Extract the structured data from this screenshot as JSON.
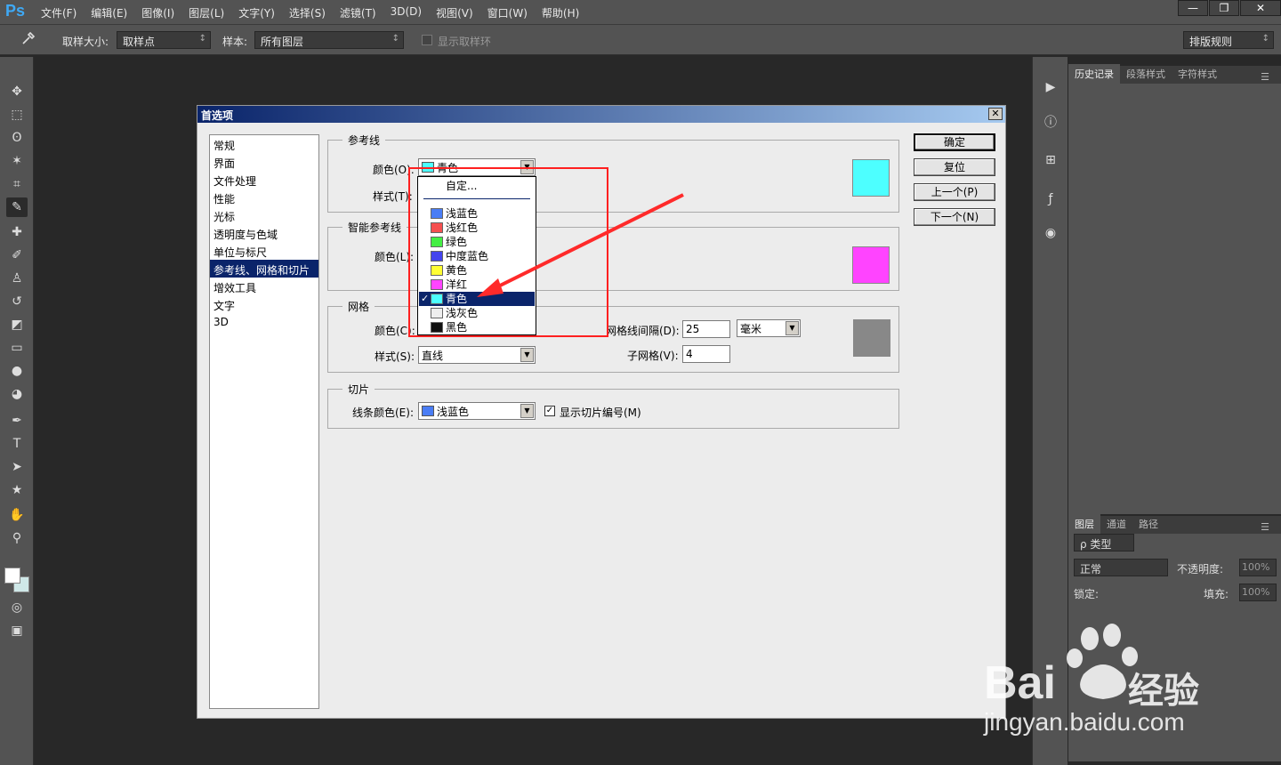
{
  "app": {
    "logo": "Ps"
  },
  "menu": [
    "文件(F)",
    "编辑(E)",
    "图像(I)",
    "图层(L)",
    "文字(Y)",
    "选择(S)",
    "滤镜(T)",
    "3D(D)",
    "视图(V)",
    "窗口(W)",
    "帮助(H)"
  ],
  "window_controls": {
    "minimize": "—",
    "restore": "❐",
    "close": "✕"
  },
  "options_bar": {
    "sample_size_label": "取样大小:",
    "sample_size_value": "取样点",
    "sample_label": "样本:",
    "sample_value": "所有图层",
    "show_ring_label": "显示取样环",
    "workspace": "排版规则"
  },
  "panels": {
    "top_tabs": [
      "历史记录",
      "段落样式",
      "字符样式"
    ],
    "layers_tabs": [
      "图层",
      "通道",
      "路径"
    ],
    "kind_filter": "ρ 类型",
    "blend_mode": "正常",
    "opacity_label": "不透明度:",
    "opacity_value": "100%",
    "lock_label": "锁定:",
    "fill_label": "填充:",
    "fill_value": "100%"
  },
  "dialog": {
    "title": "首选项",
    "close": "✕",
    "nav": [
      "常规",
      "界面",
      "文件处理",
      "性能",
      "光标",
      "透明度与色域",
      "单位与标尺",
      "参考线、网格和切片",
      "增效工具",
      "文字",
      "3D"
    ],
    "nav_selected": 7,
    "guides": {
      "title": "参考线",
      "color_label": "颜色(O):",
      "color_value": "青色",
      "style_label": "样式(T):",
      "preview_color": "#4dffff"
    },
    "smart_guides": {
      "title": "智能参考线",
      "color_label": "颜色(L):",
      "preview_color": "#ff44ff"
    },
    "grid": {
      "title": "网格",
      "color_label": "颜色(C):",
      "style_label": "样式(S):",
      "style_value": "直线",
      "gridline_label": "网格线间隔(D):",
      "gridline_value": "25",
      "unit_value": "毫米",
      "subdiv_label": "子网格(V):",
      "subdiv_value": "4",
      "preview_color": "#888888"
    },
    "slices": {
      "title": "切片",
      "line_color_label": "线条颜色(E):",
      "line_color_value": "浅蓝色",
      "line_color_swatch": "#4a7df5",
      "show_numbers_label": "显示切片编号(M)",
      "show_numbers_checked": "✓"
    },
    "buttons": {
      "ok": "确定",
      "reset": "复位",
      "prev": "上一个(P)",
      "next": "下一个(N)"
    }
  },
  "dropdown": {
    "custom": "自定...",
    "items": [
      {
        "label": "浅蓝色",
        "color": "#4a7df5"
      },
      {
        "label": "浅红色",
        "color": "#f55050"
      },
      {
        "label": "绿色",
        "color": "#44ee44"
      },
      {
        "label": "中度蓝色",
        "color": "#4444ee"
      },
      {
        "label": "黄色",
        "color": "#ffff33"
      },
      {
        "label": "洋红",
        "color": "#ff44ff"
      },
      {
        "label": "青色",
        "color": "#4dffff"
      },
      {
        "label": "浅灰色",
        "color": "#eeeeee"
      },
      {
        "label": "黑色",
        "color": "#111111"
      }
    ],
    "selected_index": 6,
    "check": "✓"
  },
  "watermark": {
    "brand": "Bai",
    "brand_cn": "经验",
    "url": "jingyan.baidu.com"
  }
}
